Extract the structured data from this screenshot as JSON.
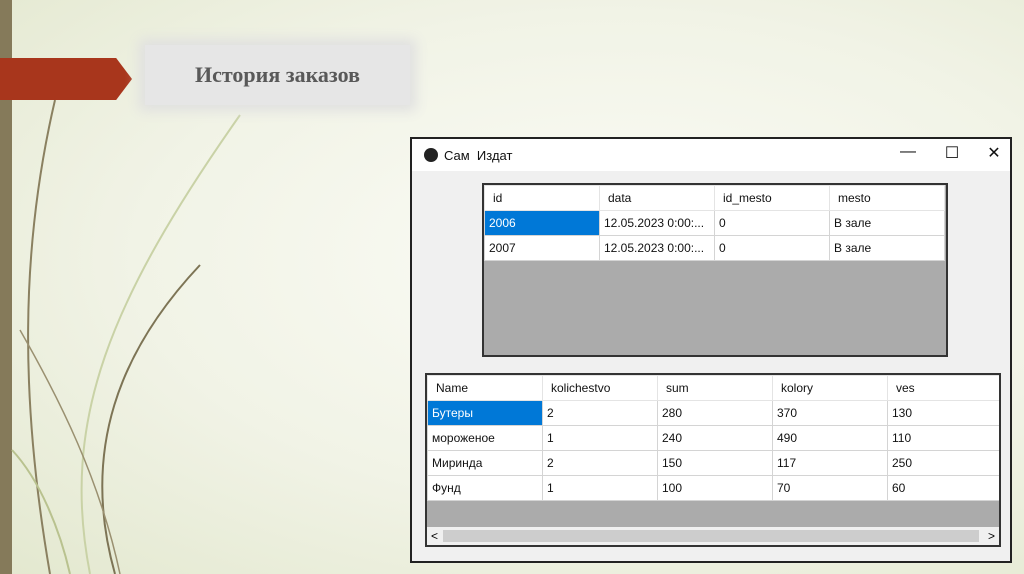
{
  "slide": {
    "title": "История заказов"
  },
  "window": {
    "title": "Сам  Издат",
    "minimize": "—",
    "maximize": "☐",
    "close": "✕"
  },
  "orders": {
    "columns": [
      "id",
      "data",
      "id_mesto",
      "mesto"
    ],
    "rows": [
      [
        "2006",
        "12.05.2023 0:00:...",
        "0",
        "В зале"
      ],
      [
        "2007",
        "12.05.2023 0:00:...",
        "0",
        "В зале"
      ]
    ]
  },
  "items": {
    "columns": [
      "Name",
      "kolichestvo",
      "sum",
      "kolory",
      "ves"
    ],
    "rows": [
      [
        "Бутеры",
        "2",
        "280",
        "370",
        "130"
      ],
      [
        "мороженое",
        "1",
        "240",
        "490",
        "110"
      ],
      [
        "Миринда",
        "2",
        "150",
        "117",
        "250"
      ],
      [
        "Фунд",
        "1",
        "100",
        "70",
        "60"
      ]
    ]
  },
  "scroll": {
    "left": "<",
    "right": ">"
  }
}
